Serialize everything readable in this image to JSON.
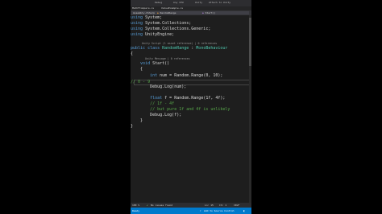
{
  "window": {
    "title_items": [
      "Debug",
      "Any CPU",
      "Unity",
      "Attach to Unity"
    ]
  },
  "tabs": [
    "MathFCompare.cs",
    "ValueExample.cs"
  ],
  "nav": {
    "project": "Assembly-CSharp",
    "class": "RandomRange",
    "member": "Start()"
  },
  "code": {
    "using1": "System;",
    "using2": "System.Collections;",
    "using3": "System.Collections.Generic;",
    "using4": "UnityEngine;",
    "class_lens": "Unity Script (1 asset reference) | 0 references",
    "class_name": "RandomRange",
    "base_class": "MonoBehaviour",
    "method_lens": "Unity Message | 0 references",
    "method_name": "Start",
    "int_var": "num",
    "range_call_1": "Random.Range(0, 10);",
    "comment_1": "// 0 - 9",
    "debug_1": "Debug.Log(num);",
    "float_var": "f",
    "range_call_2": "Random.Range(1f, 4f);",
    "comment_2": "// 1f - 4f",
    "comment_3": "// but pure 1f and 4f is unlikely",
    "debug_2": "Debug.Log(f);"
  },
  "editor_status": {
    "zoom": "100 %",
    "issues": "No issues found",
    "position": "Ln: 15",
    "column": "Ch: 1",
    "encoding": "CRLF"
  },
  "status": {
    "ready": "Ready",
    "source_control": "Add to Source Control"
  }
}
